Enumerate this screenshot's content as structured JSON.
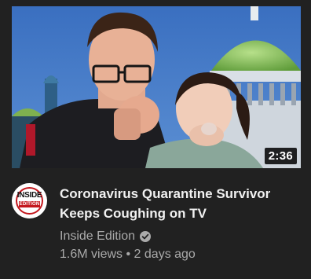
{
  "video": {
    "duration": "2:36",
    "title_line1": "Coronavirus Quarantine Survivor",
    "title_line2": "Keeps Coughing on TV",
    "views": "1.6M views",
    "separator": "•",
    "age": "2 days ago"
  },
  "channel": {
    "name": "Inside Edition",
    "avatar_text_top": "INSIDE",
    "avatar_text_bottom": "EDITION",
    "verified_icon": "verified-check-icon",
    "brand_red": "#c4171d"
  },
  "colors": {
    "background": "#212121",
    "title": "#f1f1f1",
    "secondary": "#aaaaaa"
  }
}
